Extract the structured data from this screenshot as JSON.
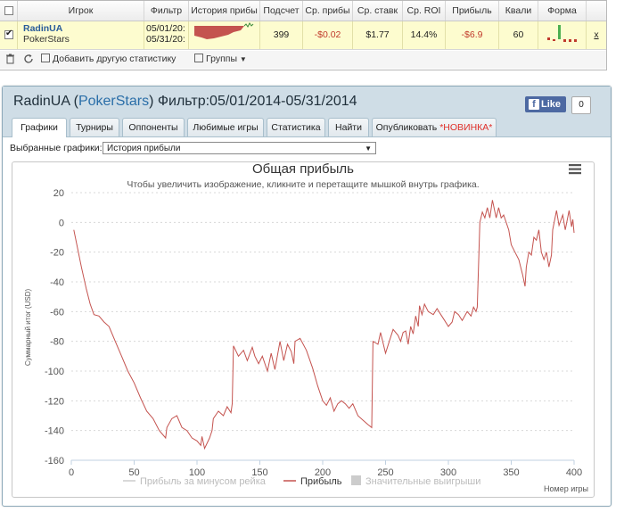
{
  "grid": {
    "headers": [
      "Игрок",
      "Фильтр",
      "История прибы",
      "Подсчет",
      "Ср. прибы",
      "Ср. ставк",
      "Ср. ROI",
      "Прибыль",
      "Квали",
      "Форма"
    ],
    "row": {
      "player_name": "RadinUA",
      "site": "PokerStars",
      "filter_line1": "05/01/20:",
      "filter_line2": "05/31/20:",
      "count": "399",
      "avg_profit": "-$0.02",
      "avg_stake": "$1.77",
      "avg_roi": "14.4%",
      "profit": "-$6.9",
      "qualify": "60",
      "remove": "x"
    },
    "footer": {
      "add_stats": "Добавить другую статистику",
      "groups": "Группы"
    }
  },
  "panel": {
    "player": "RadinUA",
    "site": "PokerStars",
    "filter": "Фильтр:05/01/2014-05/31/2014",
    "like_label": "Like",
    "like_count": "0",
    "tabs": [
      {
        "label": "Графики"
      },
      {
        "label": "Турниры"
      },
      {
        "label": "Оппоненты"
      },
      {
        "label": "Любимые игры"
      },
      {
        "label": "Статистика"
      },
      {
        "label": "Найти"
      },
      {
        "label": "Опубликовать",
        "badge": "*НОВИНКА*"
      }
    ],
    "selected_chart_label": "Выбранные графики:",
    "selected_chart_value": "История прибыли"
  },
  "colors": {
    "accent": "#2a6ea8",
    "profit_line": "#c4534f",
    "negative": "#c0392b",
    "tab_new": "#e0302a"
  },
  "chart_data": {
    "type": "line",
    "title": "Общая прибыль",
    "subtitle": "Чтобы увеличить изображение, кликните и перетащите мышкой внутрь графика.",
    "xlabel": "Номер игры",
    "ylabel": "Суммарный итог (USD)",
    "xlim": [
      0,
      400
    ],
    "ylim": [
      -160,
      20
    ],
    "xticks": [
      0,
      50,
      100,
      150,
      200,
      250,
      300,
      350,
      400
    ],
    "yticks": [
      20,
      0,
      -20,
      -40,
      -60,
      -80,
      -100,
      -120,
      -140,
      -160
    ],
    "grid": true,
    "legend_position": "bottom",
    "series": [
      {
        "name": "Прибыль за минусом рейка",
        "values": []
      },
      {
        "name": "Прибыль",
        "points": [
          [
            2,
            -5
          ],
          [
            8,
            -30
          ],
          [
            12,
            -45
          ],
          [
            15,
            -55
          ],
          [
            18,
            -62
          ],
          [
            22,
            -63
          ],
          [
            26,
            -67
          ],
          [
            30,
            -70
          ],
          [
            35,
            -80
          ],
          [
            40,
            -90
          ],
          [
            45,
            -100
          ],
          [
            50,
            -108
          ],
          [
            55,
            -118
          ],
          [
            60,
            -127
          ],
          [
            65,
            -132
          ],
          [
            70,
            -140
          ],
          [
            75,
            -145
          ],
          [
            76,
            -138
          ],
          [
            80,
            -132
          ],
          [
            84,
            -130
          ],
          [
            88,
            -138
          ],
          [
            92,
            -140
          ],
          [
            96,
            -145
          ],
          [
            100,
            -147
          ],
          [
            103,
            -150
          ],
          [
            104,
            -144
          ],
          [
            106,
            -152
          ],
          [
            110,
            -145
          ],
          [
            112,
            -140
          ],
          [
            113,
            -132
          ],
          [
            117,
            -127
          ],
          [
            121,
            -130
          ],
          [
            124,
            -124
          ],
          [
            127,
            -128
          ],
          [
            128,
            -122
          ],
          [
            129,
            -83
          ],
          [
            133,
            -90
          ],
          [
            137,
            -86
          ],
          [
            140,
            -93
          ],
          [
            144,
            -84
          ],
          [
            146,
            -90
          ],
          [
            149,
            -95
          ],
          [
            152,
            -90
          ],
          [
            156,
            -100
          ],
          [
            159,
            -88
          ],
          [
            162,
            -99
          ],
          [
            166,
            -80
          ],
          [
            169,
            -93
          ],
          [
            172,
            -82
          ],
          [
            175,
            -87
          ],
          [
            177,
            -95
          ],
          [
            178,
            -80
          ],
          [
            182,
            -78
          ],
          [
            187,
            -86
          ],
          [
            192,
            -98
          ],
          [
            196,
            -110
          ],
          [
            200,
            -120
          ],
          [
            203,
            -123
          ],
          [
            206,
            -118
          ],
          [
            209,
            -127
          ],
          [
            212,
            -122
          ],
          [
            215,
            -120
          ],
          [
            218,
            -122
          ],
          [
            221,
            -125
          ],
          [
            224,
            -122
          ],
          [
            228,
            -130
          ],
          [
            232,
            -133
          ],
          [
            236,
            -136
          ],
          [
            239,
            -138
          ],
          [
            240,
            -80
          ],
          [
            244,
            -82
          ],
          [
            246,
            -74
          ],
          [
            250,
            -88
          ],
          [
            253,
            -80
          ],
          [
            256,
            -72
          ],
          [
            260,
            -76
          ],
          [
            262,
            -80
          ],
          [
            264,
            -74
          ],
          [
            266,
            -73
          ],
          [
            268,
            -82
          ],
          [
            270,
            -70
          ],
          [
            272,
            -75
          ],
          [
            274,
            -63
          ],
          [
            276,
            -70
          ],
          [
            277,
            -56
          ],
          [
            279,
            -62
          ],
          [
            281,
            -55
          ],
          [
            284,
            -60
          ],
          [
            288,
            -62
          ],
          [
            291,
            -58
          ],
          [
            294,
            -62
          ],
          [
            297,
            -66
          ],
          [
            300,
            -70
          ],
          [
            303,
            -67
          ],
          [
            305,
            -60
          ],
          [
            308,
            -62
          ],
          [
            311,
            -66
          ],
          [
            315,
            -60
          ],
          [
            318,
            -63
          ],
          [
            320,
            -57
          ],
          [
            322,
            -60
          ],
          [
            323,
            -57
          ],
          [
            325,
            0
          ],
          [
            327,
            7
          ],
          [
            329,
            3
          ],
          [
            331,
            10
          ],
          [
            333,
            3
          ],
          [
            335,
            15
          ],
          [
            338,
            3
          ],
          [
            340,
            10
          ],
          [
            342,
            3
          ],
          [
            344,
            5
          ],
          [
            348,
            -5
          ],
          [
            350,
            -15
          ],
          [
            353,
            -20
          ],
          [
            356,
            -25
          ],
          [
            359,
            -35
          ],
          [
            361,
            -43
          ],
          [
            362,
            -30
          ],
          [
            364,
            -20
          ],
          [
            366,
            -22
          ],
          [
            368,
            -10
          ],
          [
            370,
            -12
          ],
          [
            372,
            -5
          ],
          [
            374,
            -20
          ],
          [
            376,
            -25
          ],
          [
            378,
            -20
          ],
          [
            380,
            -30
          ],
          [
            382,
            -22
          ],
          [
            383,
            -5
          ],
          [
            386,
            8
          ],
          [
            388,
            -2
          ],
          [
            391,
            5
          ],
          [
            393,
            -5
          ],
          [
            396,
            8
          ],
          [
            398,
            -3
          ],
          [
            399,
            2
          ],
          [
            400,
            -7
          ]
        ]
      },
      {
        "name": "Значительные выигрыши",
        "values": []
      }
    ]
  }
}
